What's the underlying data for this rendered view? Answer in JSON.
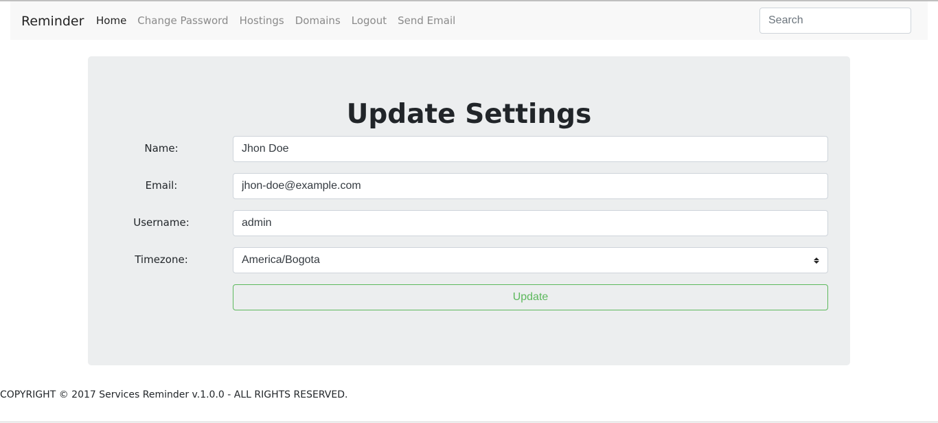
{
  "navbar": {
    "brand": "Reminder",
    "links": [
      {
        "label": "Home",
        "active": true
      },
      {
        "label": "Change Password",
        "active": false
      },
      {
        "label": "Hostings",
        "active": false
      },
      {
        "label": "Domains",
        "active": false
      },
      {
        "label": "Logout",
        "active": false
      },
      {
        "label": "Send Email",
        "active": false
      }
    ],
    "search_placeholder": "Search"
  },
  "form": {
    "title": "Update Settings",
    "name_label": "Name:",
    "name_value": "Jhon Doe",
    "email_label": "Email:",
    "email_value": "jhon-doe@example.com",
    "username_label": "Username:",
    "username_value": "admin",
    "timezone_label": "Timezone:",
    "timezone_value": "America/Bogota",
    "submit_label": "Update"
  },
  "footer": {
    "text": "COPYRIGHT © 2017 Services Reminder v.1.0.0 - ALL RIGHTS RESERVED."
  },
  "colors": {
    "accent_green": "#5cb85c",
    "navbar_bg": "#f8f8f8",
    "card_bg": "#eceeef"
  }
}
